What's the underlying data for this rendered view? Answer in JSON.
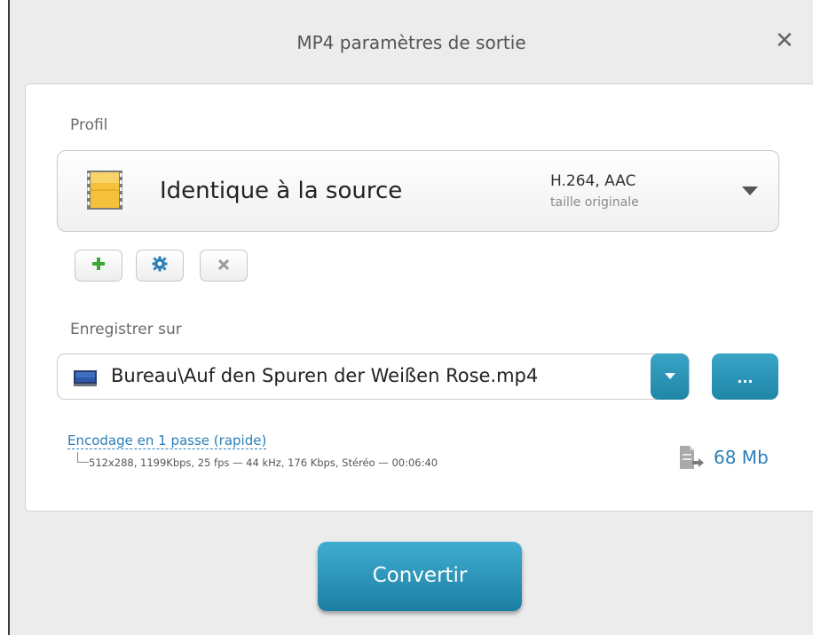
{
  "dialog": {
    "title": "MP4 paramètres de sortie",
    "close_icon": "close-icon"
  },
  "profile": {
    "label": "Profil",
    "selected_name": "Identique à la source",
    "codec": "H.264, AAC",
    "size_note": "taille originale",
    "icon": "film-icon"
  },
  "profile_actions": {
    "add_icon": "plus-icon",
    "settings_icon": "gear-icon",
    "delete_icon": "x-icon"
  },
  "save": {
    "label": "Enregistrer sur",
    "path": "Bureau\\Auf den Spuren der Weißen Rose.mp4",
    "browse_label": "..."
  },
  "encoding": {
    "mode_link": "Encodage en 1 passe (rapide)",
    "details": "512x288, 1199Kbps, 25 fps — 44 kHz, 176 Kbps, Stéréo — 00:06:40",
    "estimated_size": "68 Mb"
  },
  "convert_label": "Convertir",
  "colors": {
    "accent": "#2a90b5",
    "link": "#2a7fb8",
    "add_green": "#3aa832",
    "gear_blue": "#2a7fb8"
  }
}
